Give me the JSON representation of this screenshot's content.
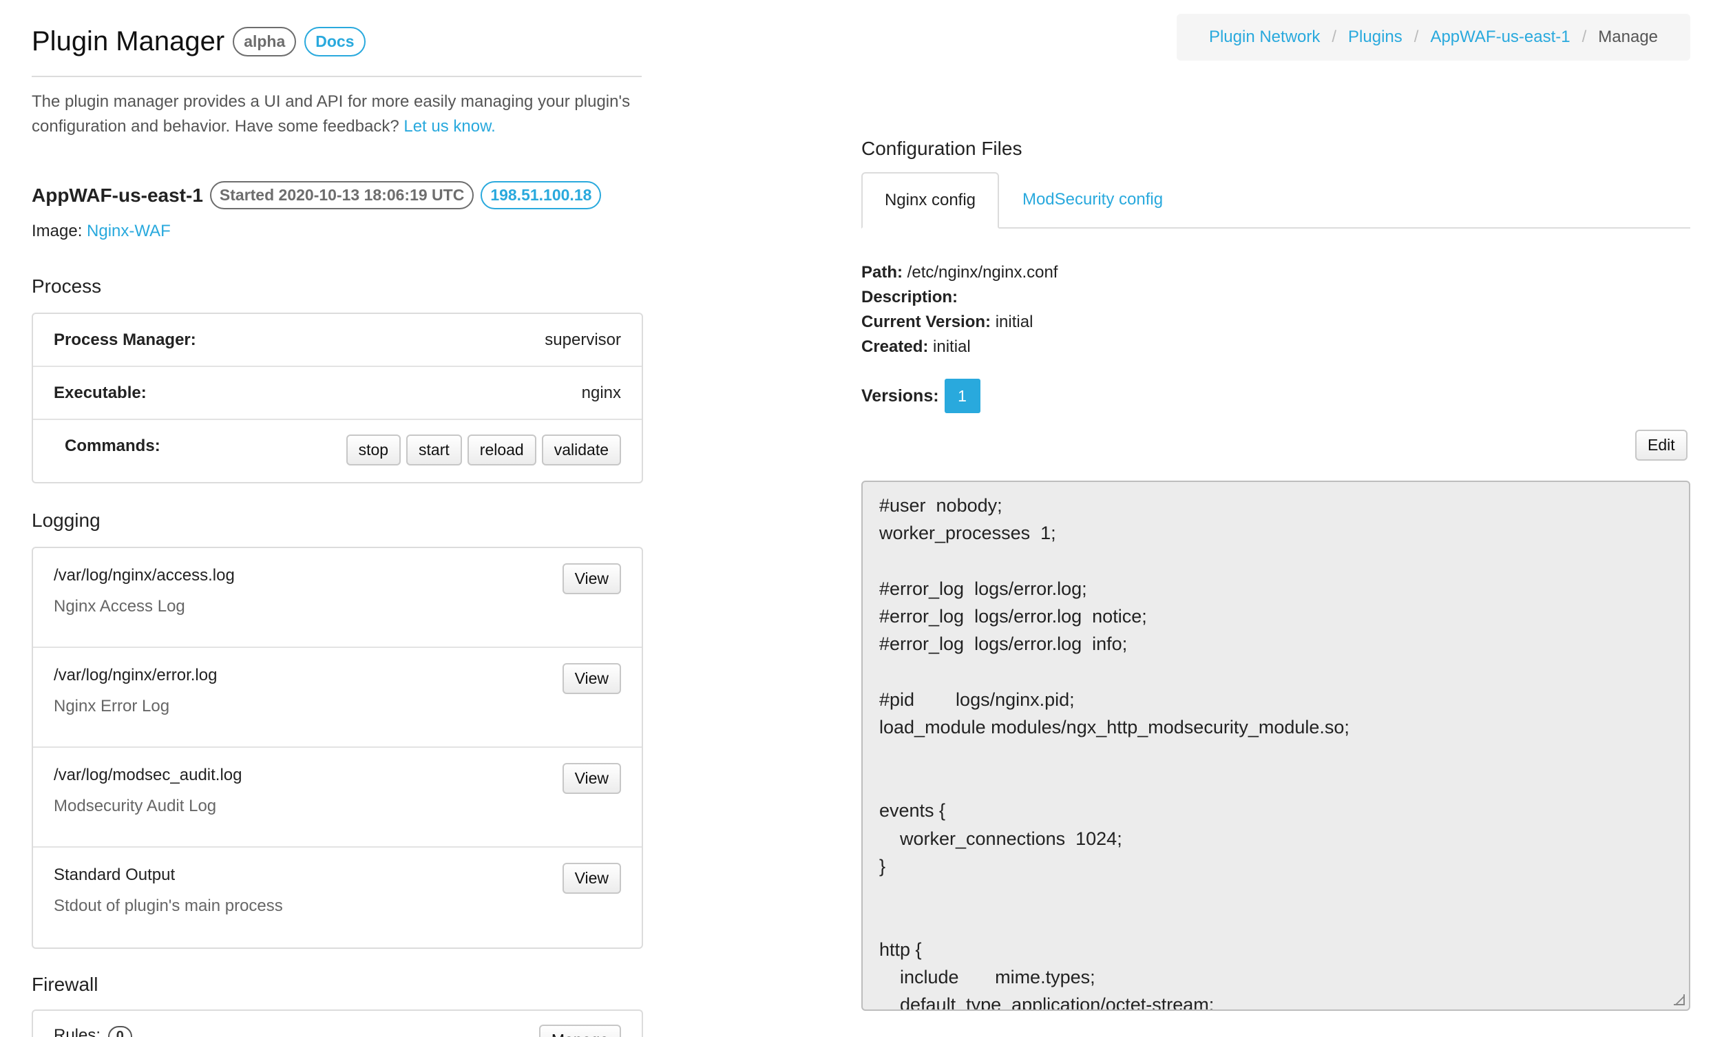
{
  "header": {
    "title": "Plugin Manager",
    "alpha_badge": "alpha",
    "docs_badge": "Docs",
    "intro_text": "The plugin manager provides a UI and API for more easily managing your plugin's configuration and behavior. Have some feedback?",
    "intro_link": "Let us know."
  },
  "breadcrumb": {
    "items": [
      "Plugin Network",
      "Plugins",
      "AppWAF-us-east-1"
    ],
    "active": "Manage",
    "separator": "/"
  },
  "instance": {
    "name": "AppWAF-us-east-1",
    "started": "Started 2020-10-13 18:06:19 UTC",
    "ip": "198.51.100.18",
    "image_label": "Image:",
    "image_link": "Nginx-WAF"
  },
  "process": {
    "title": "Process",
    "manager_label": "Process Manager:",
    "manager_value": "supervisor",
    "executable_label": "Executable:",
    "executable_value": "nginx",
    "commands_label": "Commands:",
    "commands": [
      "stop",
      "start",
      "reload",
      "validate"
    ]
  },
  "logging": {
    "title": "Logging",
    "view_label": "View",
    "items": [
      {
        "path": "/var/log/nginx/access.log",
        "desc": "Nginx Access Log"
      },
      {
        "path": "/var/log/nginx/error.log",
        "desc": "Nginx Error Log"
      },
      {
        "path": "/var/log/modsec_audit.log",
        "desc": "Modsecurity Audit Log"
      },
      {
        "path": "Standard Output",
        "desc": "Stdout of plugin's main process"
      }
    ]
  },
  "firewall": {
    "title": "Firewall",
    "rules_label": "Rules:",
    "rules_count": "0",
    "manage_label": "Manage"
  },
  "config": {
    "title": "Configuration Files",
    "tabs": [
      "Nginx config",
      "ModSecurity config"
    ],
    "active_tab": 0,
    "path_label": "Path:",
    "path_value": "/etc/nginx/nginx.conf",
    "description_label": "Description:",
    "description_value": "",
    "current_version_label": "Current Version:",
    "current_version_value": "initial",
    "created_label": "Created:",
    "created_value": "initial",
    "versions_label": "Versions:",
    "versions": [
      "1"
    ],
    "edit_label": "Edit",
    "code_lines": [
      "#user  nobody;",
      "worker_processes  1;",
      "",
      "#error_log  logs/error.log;",
      "#error_log  logs/error.log  notice;",
      "#error_log  logs/error.log  info;",
      "",
      "#pid        logs/nginx.pid;",
      "load_module modules/ngx_http_modsecurity_module.so;",
      "",
      "",
      "events {",
      "    worker_connections  1024;",
      "}",
      "",
      "",
      "http {",
      "    include       mime.types;",
      "    default_type  application/octet-stream;"
    ]
  },
  "colors": {
    "accent": "#29a9dd",
    "muted_badge": "#6d6d6d"
  }
}
